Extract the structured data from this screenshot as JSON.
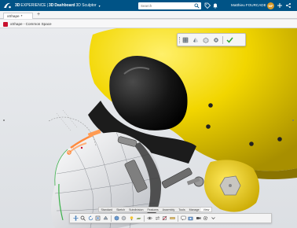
{
  "topbar": {
    "brand_bold": "3D",
    "brand_experience": "EXPERIENCE",
    "divider": "|",
    "dashboard_bold": "3D",
    "dashboard_rest": "Dashboard",
    "app_name": "3D Sculptor",
    "search_placeholder": "Search",
    "user_name": "Matthieu FOURCADE",
    "user_initials": "MF",
    "brand_color": "#005386",
    "logo_icon": "3ds-compass-logo-icon"
  },
  "tabbar": {
    "active_tab": "xShape",
    "add_tab_glyph": "+"
  },
  "breadcrumb": {
    "text": "xShape - Common Space"
  },
  "colors": {
    "helmet_yellow": "#f2d600",
    "visor_dark": "#1a1a1a",
    "mask_white": "#f2f2f2",
    "accent_red": "#c8102e",
    "accent_orange": "#ff8a3d",
    "validate_green": "#2fa52f"
  },
  "action_bar": {
    "icons": [
      "subdivide-icon",
      "mirror-icon",
      "cage-icon",
      "tool-options-icon",
      "validate-check-icon"
    ]
  },
  "section_tabs": [
    "Standard",
    "Sketch",
    "Subdivision",
    "Features",
    "Assembly",
    "Tools",
    "Manage",
    "View"
  ],
  "active_section_tab": "View",
  "bottom_toolbar": {
    "icons": [
      "pan-icon",
      "zoom-icon",
      "rotate-icon",
      "fit-all-icon",
      "normal-view-icon",
      "view-cube-icon",
      "render-style-icon",
      "lighting-icon",
      "ground-icon",
      "hide-show-icon",
      "swap-visible-icon",
      "clipping-icon",
      "measure-icon",
      "annotation-icon",
      "capture-icon",
      "camera-icon",
      "settings-icon",
      "more-icon"
    ]
  }
}
